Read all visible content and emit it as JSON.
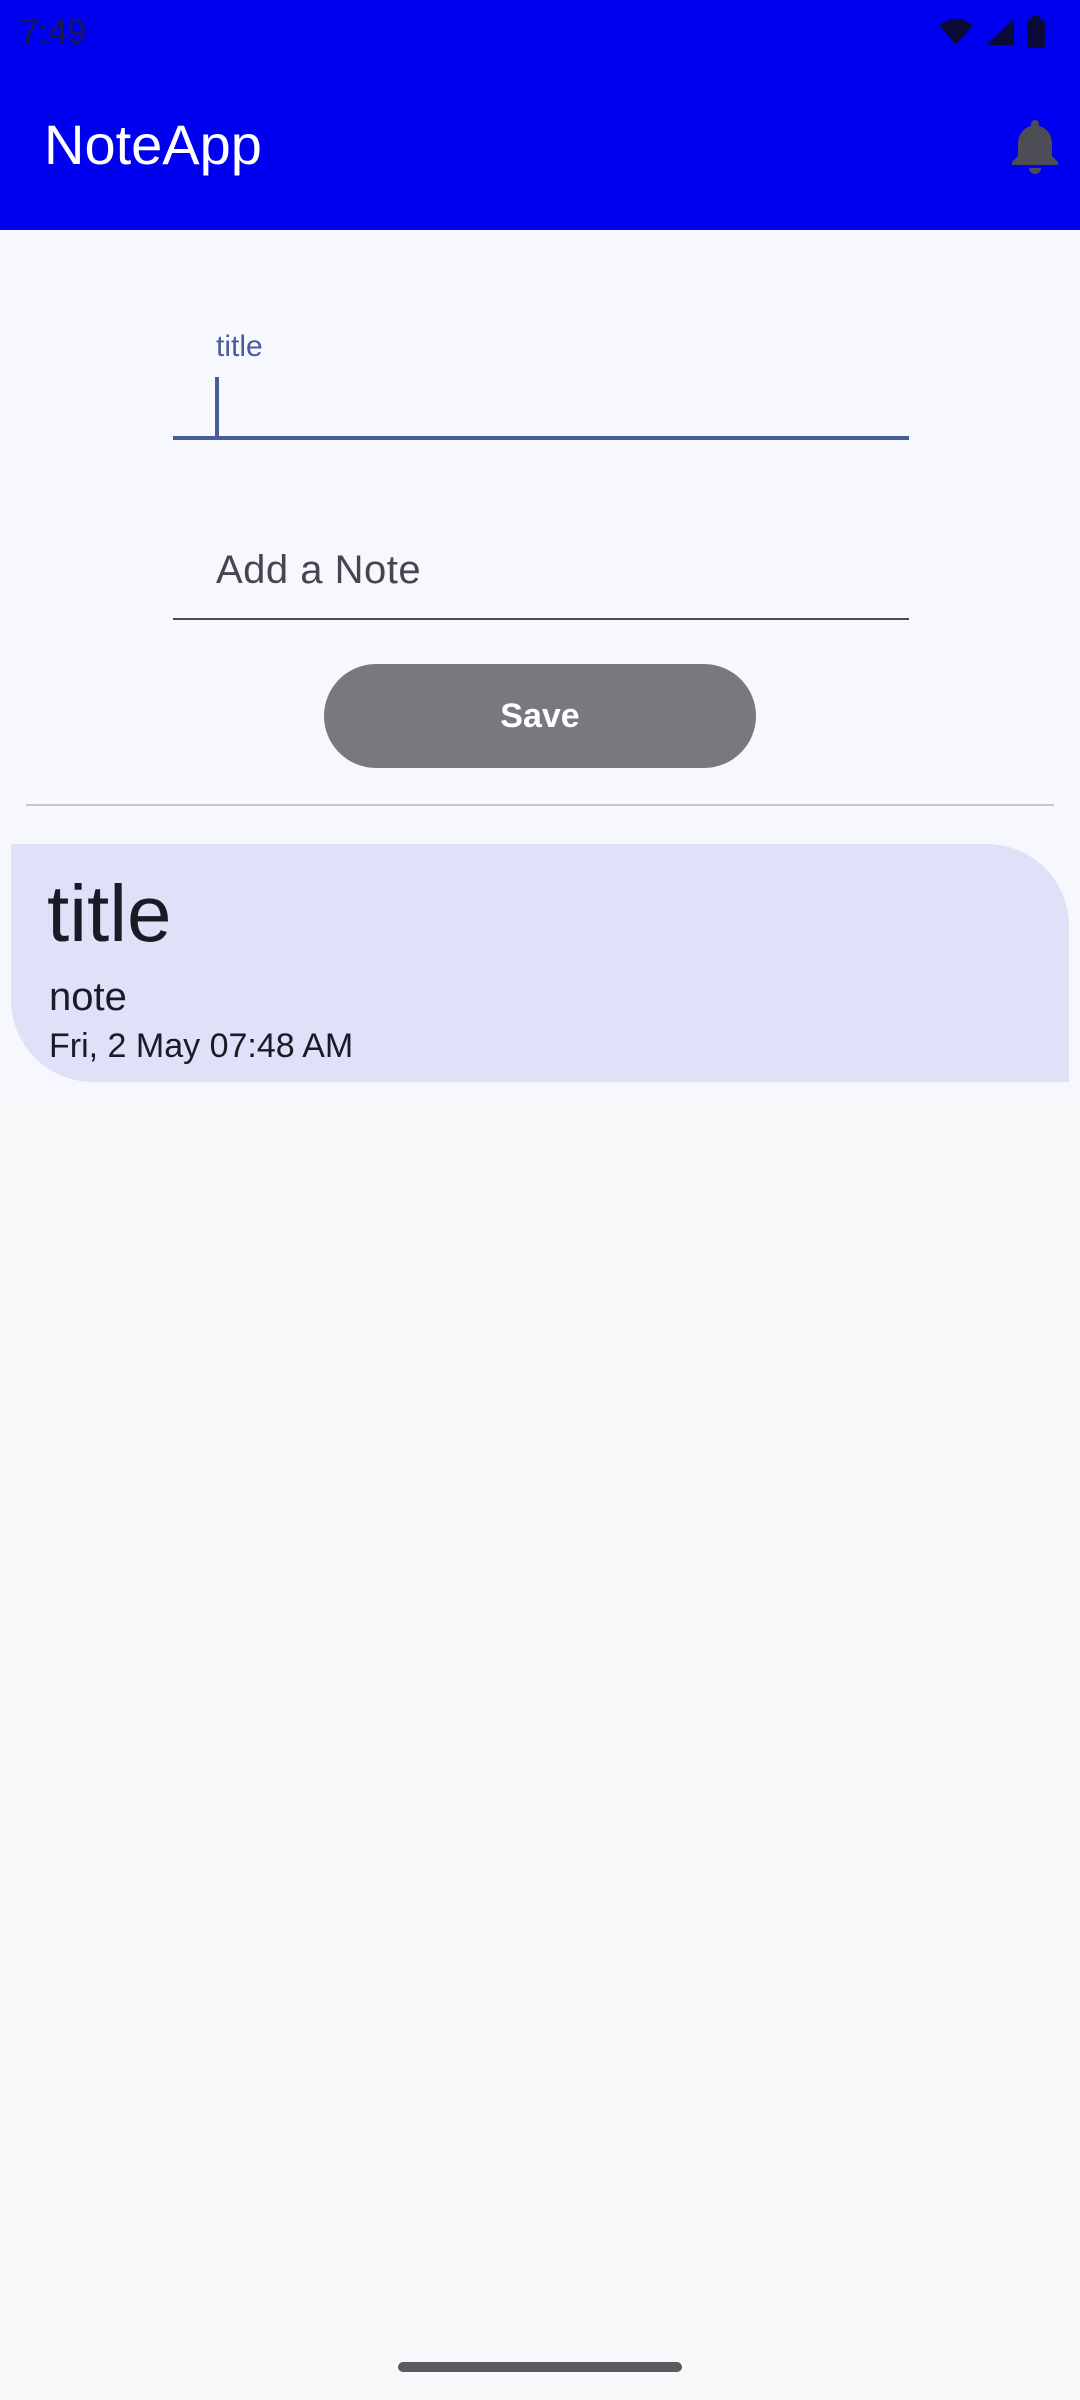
{
  "status_bar": {
    "time": "7:49",
    "icons": [
      "wifi-icon",
      "signal-icon",
      "battery-icon"
    ]
  },
  "app_bar": {
    "title": "NoteApp",
    "action_icon": "notification-bell-icon",
    "background_color": "#0000f0"
  },
  "form": {
    "title_field": {
      "label": "title",
      "value": ""
    },
    "note_field": {
      "placeholder": "Add a Note",
      "value": ""
    },
    "save_label": "Save"
  },
  "notes": [
    {
      "title": "title",
      "note": "note",
      "date": "Fri, 2 May 07:48 AM"
    }
  ]
}
